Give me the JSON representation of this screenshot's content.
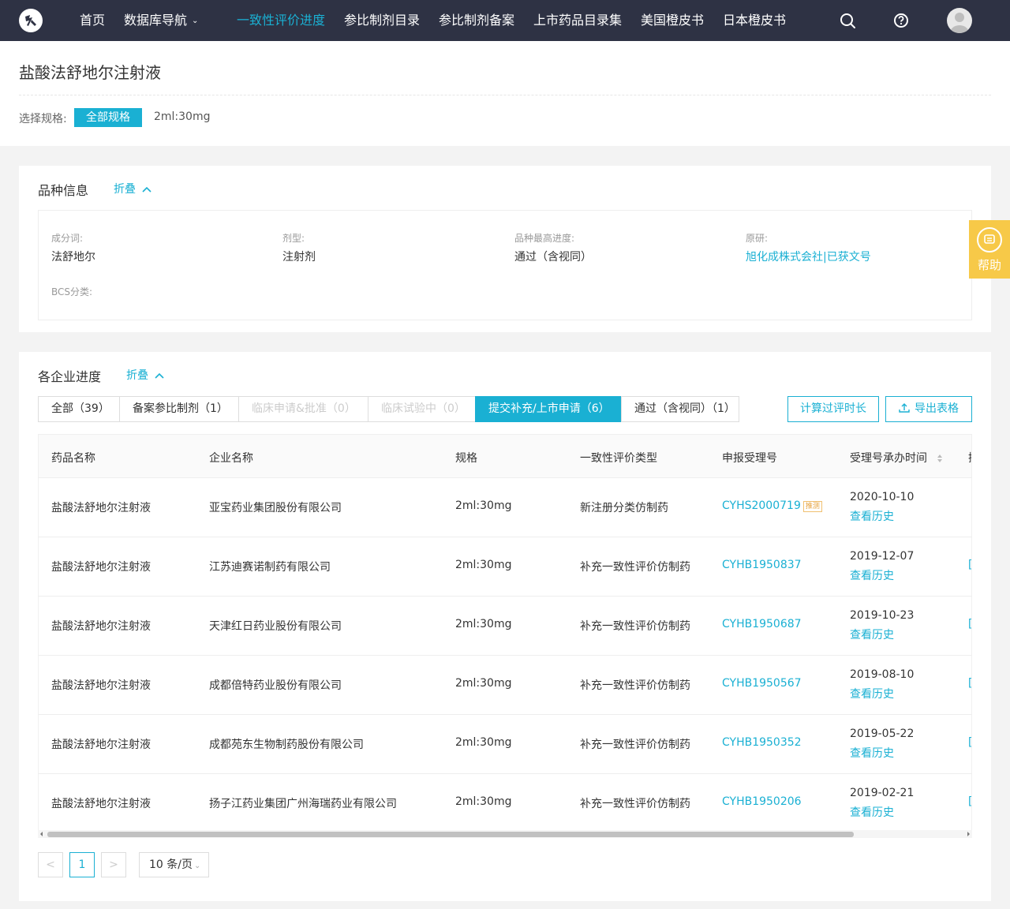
{
  "nav": {
    "items": [
      {
        "label": "首页"
      },
      {
        "label": "数据库导航",
        "has_caret": true
      },
      {
        "label": "一致性评价进度",
        "active": true
      },
      {
        "label": "参比制剂目录"
      },
      {
        "label": "参比制剂备案"
      },
      {
        "label": "上市药品目录集"
      },
      {
        "label": "美国橙皮书"
      },
      {
        "label": "日本橙皮书"
      }
    ],
    "caret": "⌄",
    "accent_color": "#1ab0d3",
    "bg_color": "#2e3244"
  },
  "header": {
    "title": "盐酸法舒地尔注射液",
    "spec_label": "选择规格:",
    "spec_all": "全部规格",
    "spec_option": "2ml:30mg"
  },
  "variety": {
    "title": "品种信息",
    "fold": "折叠",
    "fields": {
      "ingredient_label": "成分词:",
      "ingredient_value": "法舒地尔",
      "dosage_label": "剂型:",
      "dosage_value": "注射剂",
      "progress_label": "品种最高进度:",
      "progress_value": "通过（含视同）",
      "original_label": "原研:",
      "original_value": "旭化成株式会社|已获文号",
      "bcs_label": "BCS分类:"
    }
  },
  "company": {
    "title": "各企业进度",
    "fold": "折叠",
    "tabs": [
      {
        "label": "全部（39）",
        "state": "normal"
      },
      {
        "label": "备案参比制剂（1）",
        "state": "normal"
      },
      {
        "label": "临床申请&批准（0）",
        "state": "disabled"
      },
      {
        "label": "临床试验中（0）",
        "state": "disabled"
      },
      {
        "label": "提交补充/上市申请（6）",
        "state": "active"
      },
      {
        "label": "通过（含视同）（1）",
        "state": "normal"
      }
    ],
    "calc_button": "计算过评时长",
    "export_button": "导出表格",
    "columns": [
      "药品名称",
      "企业名称",
      "规格",
      "一致性评价类型",
      "申报受理号",
      "受理号承办时间",
      "操"
    ],
    "rows": [
      {
        "drug": "盐酸法舒地尔注射液",
        "company": "亚宝药业集团股份有限公司",
        "spec": "2ml:30mg",
        "type": "新注册分类仿制药",
        "code": "CYHS2000719",
        "tag": "推测",
        "date": "2020-10-10",
        "history": "查看历史",
        "cut": ""
      },
      {
        "drug": "盐酸法舒地尔注射液",
        "company": "江苏迪赛诺制药有限公司",
        "spec": "2ml:30mg",
        "type": "补充一致性评价仿制药",
        "code": "CYHB1950837",
        "tag": "",
        "date": "2019-12-07",
        "history": "查看历史",
        "cut": "[]"
      },
      {
        "drug": "盐酸法舒地尔注射液",
        "company": "天津红日药业股份有限公司",
        "spec": "2ml:30mg",
        "type": "补充一致性评价仿制药",
        "code": "CYHB1950687",
        "tag": "",
        "date": "2019-10-23",
        "history": "查看历史",
        "cut": "[]"
      },
      {
        "drug": "盐酸法舒地尔注射液",
        "company": "成都倍特药业股份有限公司",
        "spec": "2ml:30mg",
        "type": "补充一致性评价仿制药",
        "code": "CYHB1950567",
        "tag": "",
        "date": "2019-08-10",
        "history": "查看历史",
        "cut": "[]"
      },
      {
        "drug": "盐酸法舒地尔注射液",
        "company": "成都苑东生物制药股份有限公司",
        "spec": "2ml:30mg",
        "type": "补充一致性评价仿制药",
        "code": "CYHB1950352",
        "tag": "",
        "date": "2019-05-22",
        "history": "查看历史",
        "cut": "[]"
      },
      {
        "drug": "盐酸法舒地尔注射液",
        "company": "扬子江药业集团广州海瑞药业有限公司",
        "spec": "2ml:30mg",
        "type": "补充一致性评价仿制药",
        "code": "CYHB1950206",
        "tag": "",
        "date": "2019-02-21",
        "history": "查看历史",
        "cut": "[]"
      }
    ]
  },
  "pagination": {
    "prev": "<",
    "page": "1",
    "next": ">",
    "page_size": "10 条/页"
  },
  "help": {
    "label": "帮助",
    "color": "#f7c948"
  }
}
